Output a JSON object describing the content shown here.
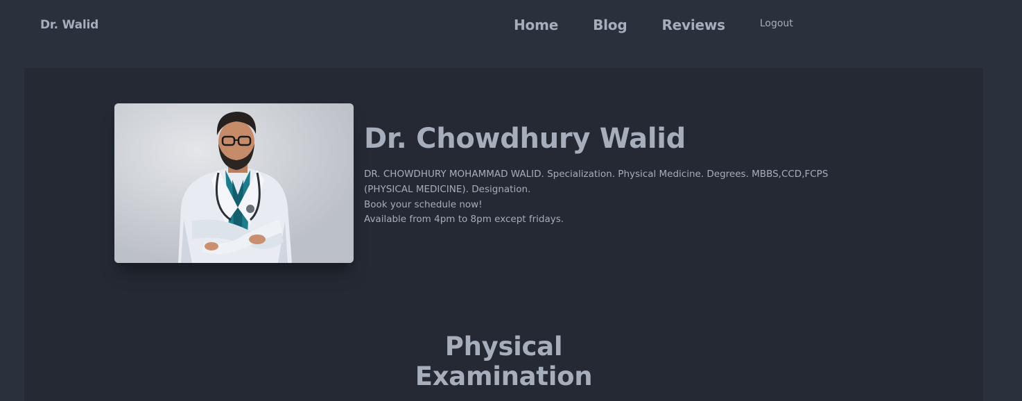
{
  "navbar": {
    "brand": "Dr. Walid",
    "links": [
      {
        "label": "Home"
      },
      {
        "label": "Blog"
      },
      {
        "label": "Reviews"
      }
    ],
    "logout_label": "Logout"
  },
  "hero": {
    "name": "Dr. Chowdhury Walid",
    "description_line1": "DR. CHOWDHURY MOHAMMAD WALID. Specialization. Physical Medicine. Degrees. MBBS,CCD,FCPS (PHYSICAL MEDICINE). Designation.",
    "description_line2": "Book your schedule now!",
    "description_line3": "Available from 4pm to 8pm except fridays."
  },
  "section": {
    "title": "Physical Examination"
  },
  "colors": {
    "page_bg": "#2a303c",
    "hero_bg": "#242933",
    "text": "#a6adbb"
  }
}
